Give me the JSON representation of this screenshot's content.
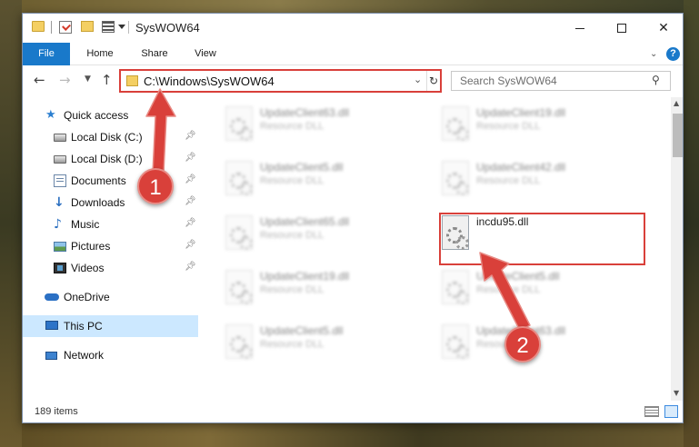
{
  "window": {
    "title": "SysWOW64"
  },
  "ribbon": {
    "tabs": [
      "File",
      "Home",
      "Share",
      "View"
    ]
  },
  "address": {
    "path": "C:\\Windows\\SysWOW64"
  },
  "search": {
    "placeholder": "Search SysWOW64"
  },
  "sidebar": {
    "items": [
      {
        "label": "Quick access",
        "icon": "star-icon"
      },
      {
        "label": "Local Disk (C:)",
        "icon": "disk-icon",
        "pinned": true
      },
      {
        "label": "Local Disk (D:)",
        "icon": "disk-icon",
        "pinned": true
      },
      {
        "label": "Documents",
        "icon": "documents-icon",
        "pinned": true
      },
      {
        "label": "Downloads",
        "icon": "download-icon",
        "pinned": true
      },
      {
        "label": "Music",
        "icon": "music-icon",
        "pinned": true
      },
      {
        "label": "Pictures",
        "icon": "pictures-icon",
        "pinned": true
      },
      {
        "label": "Videos",
        "icon": "videos-icon",
        "pinned": true
      },
      {
        "label": "OneDrive",
        "icon": "cloud-icon"
      },
      {
        "label": "This PC",
        "icon": "computer-icon",
        "selected": true
      },
      {
        "label": "Network",
        "icon": "network-icon"
      }
    ]
  },
  "files": [
    {
      "name": "UpdateClient63.dll",
      "type": "Resource DLL"
    },
    {
      "name": "UpdateClient19.dll",
      "type": "Resource DLL"
    },
    {
      "name": "UpdateClient5.dll",
      "type": "Resource DLL"
    },
    {
      "name": "UpdateClient42.dll",
      "type": "Resource DLL"
    },
    {
      "name": "UpdateClient65.dll",
      "type": "Resource DLL"
    },
    {
      "name": "incdu95.dll",
      "type": ""
    },
    {
      "name": "UpdateClient19.dll",
      "type": "Resource DLL"
    },
    {
      "name": "UpdateClient5.dll",
      "type": "Resource DLL"
    },
    {
      "name": "UpdateClient5.dll",
      "type": "Resource DLL"
    },
    {
      "name": "UpdateClient63.dll",
      "type": "Resource DLL"
    }
  ],
  "status": {
    "item_count": "189 items"
  },
  "annotations": {
    "step1": "1",
    "step2": "2",
    "color": "#d9403a"
  }
}
